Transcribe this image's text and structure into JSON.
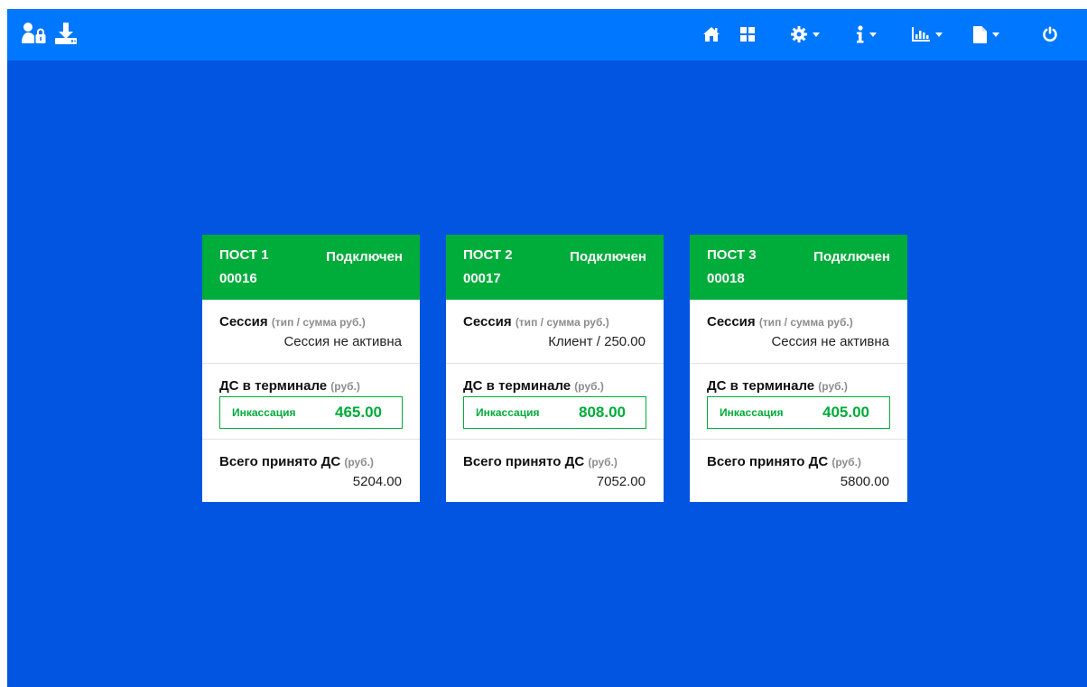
{
  "navbar": {
    "left_icons": [
      "user-lock-icon",
      "download-icon"
    ],
    "right_items": [
      {
        "icon": "home-icon",
        "dropdown": false
      },
      {
        "icon": "grid-icon",
        "dropdown": false
      },
      {
        "icon": "gear-icon",
        "dropdown": true
      },
      {
        "icon": "info-icon",
        "dropdown": true
      },
      {
        "icon": "chart-icon",
        "dropdown": true
      },
      {
        "icon": "file-icon",
        "dropdown": true
      },
      {
        "icon": "power-icon",
        "dropdown": false
      }
    ]
  },
  "colors": {
    "navbar": "#0077ff",
    "background": "#0155e0",
    "connected": "#00ac3a"
  },
  "posts": [
    {
      "name": "ПОСТ 1",
      "id": "00016",
      "status": "Подключен",
      "session_title": "Сессия",
      "session_hint": "(тип / сумма руб.)",
      "session_value": "Сессия не активна",
      "terminal_title": "ДС в терминале",
      "terminal_hint": "(руб.)",
      "collect_label": "Инкассация",
      "collect_amount": "465.00",
      "total_title": "Всего принято ДС",
      "total_hint": "(руб.)",
      "total_value": "5204.00"
    },
    {
      "name": "ПОСТ 2",
      "id": "00017",
      "status": "Подключен",
      "session_title": "Сессия",
      "session_hint": "(тип / сумма руб.)",
      "session_value": "Клиент / 250.00",
      "terminal_title": "ДС в терминале",
      "terminal_hint": "(руб.)",
      "collect_label": "Инкассация",
      "collect_amount": "808.00",
      "total_title": "Всего принято ДС",
      "total_hint": "(руб.)",
      "total_value": "7052.00"
    },
    {
      "name": "ПОСТ 3",
      "id": "00018",
      "status": "Подключен",
      "session_title": "Сессия",
      "session_hint": "(тип / сумма руб.)",
      "session_value": "Сессия не активна",
      "terminal_title": "ДС в терминале",
      "terminal_hint": "(руб.)",
      "collect_label": "Инкассация",
      "collect_amount": "405.00",
      "total_title": "Всего принято ДС",
      "total_hint": "(руб.)",
      "total_value": "5800.00"
    }
  ]
}
